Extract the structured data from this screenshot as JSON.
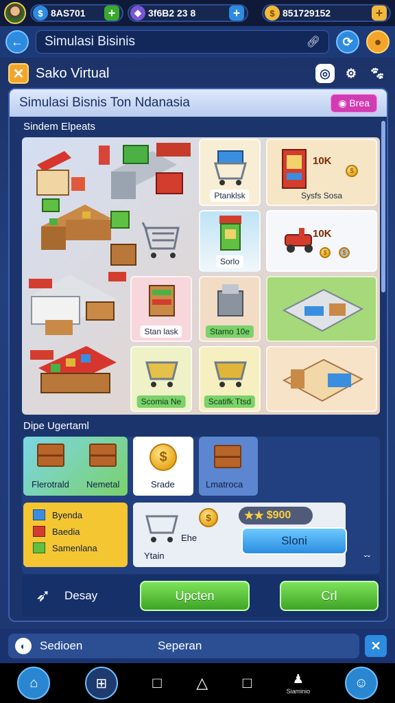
{
  "status": {
    "resource1": "8AS701",
    "resource2": "3f6B2 23 8",
    "resource3": "851729152"
  },
  "titlebar": {
    "back_icon": "arrow-left-icon",
    "title": "Simulasi Bisinis",
    "link_icon": "link-icon"
  },
  "header": {
    "app_name": "Sako Virtual"
  },
  "panel": {
    "title": "Simulasi Bisnis Ton Ndanasia",
    "info_pill": "Brea",
    "shop_section": "Sindem Elpeats",
    "upgrade_section": "Dipe Ugertaml"
  },
  "shop_cards": {
    "card1": "Ptanklsk",
    "card2": "Sysfs Sosa",
    "card2_price": "10K",
    "card3": "Sorlo",
    "card3_price": "10K",
    "card4": "Stan lask",
    "card5": "Stamo 10e",
    "card6": "Scomia Ne",
    "card7": "Scatifk Ttsd"
  },
  "upgrades": {
    "card1_left": "Flerotrald",
    "card1_right": "Nemetal",
    "card2": "Srade",
    "card3": "Lmatroca",
    "list": [
      "Byenda",
      "Baedia",
      "Samenlana"
    ],
    "cart_label_top": "Ehe",
    "cart_label_bottom": "Ytain",
    "price": "$900",
    "buy_button": "Sloni"
  },
  "actions": {
    "label": "Desay",
    "upgrade_button": "Upcten",
    "ok_button": "Crl"
  },
  "bottom": {
    "left_label": "Sedioen",
    "center_label": "Seperan"
  },
  "nav": {
    "caption": "Siaminio"
  },
  "colors": {
    "background": "#1b2f63",
    "panel": "#1b346c",
    "accent_green": "#4fbf31",
    "accent_blue": "#2a8de0",
    "accent_pink": "#d13cb3",
    "accent_gold": "#f3a52b"
  }
}
